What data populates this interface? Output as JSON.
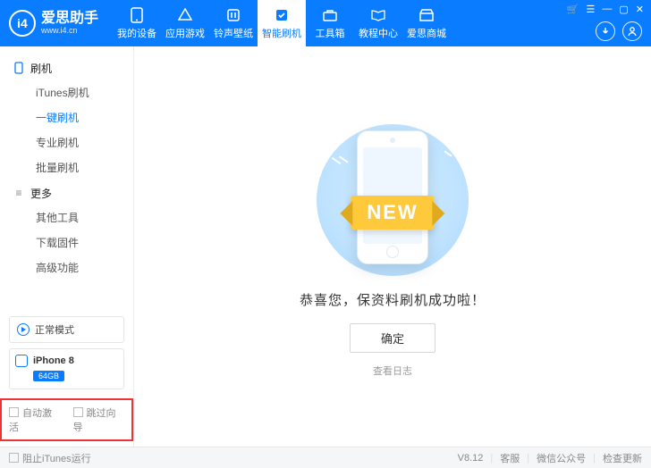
{
  "header": {
    "brand": "爱思助手",
    "url": "www.i4.cn",
    "tabs": [
      {
        "label": "我的设备"
      },
      {
        "label": "应用游戏"
      },
      {
        "label": "铃声壁纸"
      },
      {
        "label": "智能刷机"
      },
      {
        "label": "工具箱"
      },
      {
        "label": "教程中心"
      },
      {
        "label": "爱思商城"
      }
    ]
  },
  "sidebar": {
    "group_flash": "刷机",
    "flash_items": [
      "iTunes刷机",
      "一键刷机",
      "专业刷机",
      "批量刷机"
    ],
    "group_more": "更多",
    "more_items": [
      "其他工具",
      "下载固件",
      "高级功能"
    ],
    "status_mode": "正常模式",
    "device_name": "iPhone 8",
    "device_capacity": "64GB",
    "opt_auto_activate": "自动激活",
    "opt_skip_guide": "跳过向导"
  },
  "main": {
    "ribbon": "NEW",
    "success": "恭喜您，保资料刷机成功啦！",
    "confirm": "确定",
    "view_log": "查看日志"
  },
  "footer": {
    "block_itunes": "阻止iTunes运行",
    "version": "V8.12",
    "support": "客服",
    "wechat": "微信公众号",
    "update": "检查更新"
  }
}
